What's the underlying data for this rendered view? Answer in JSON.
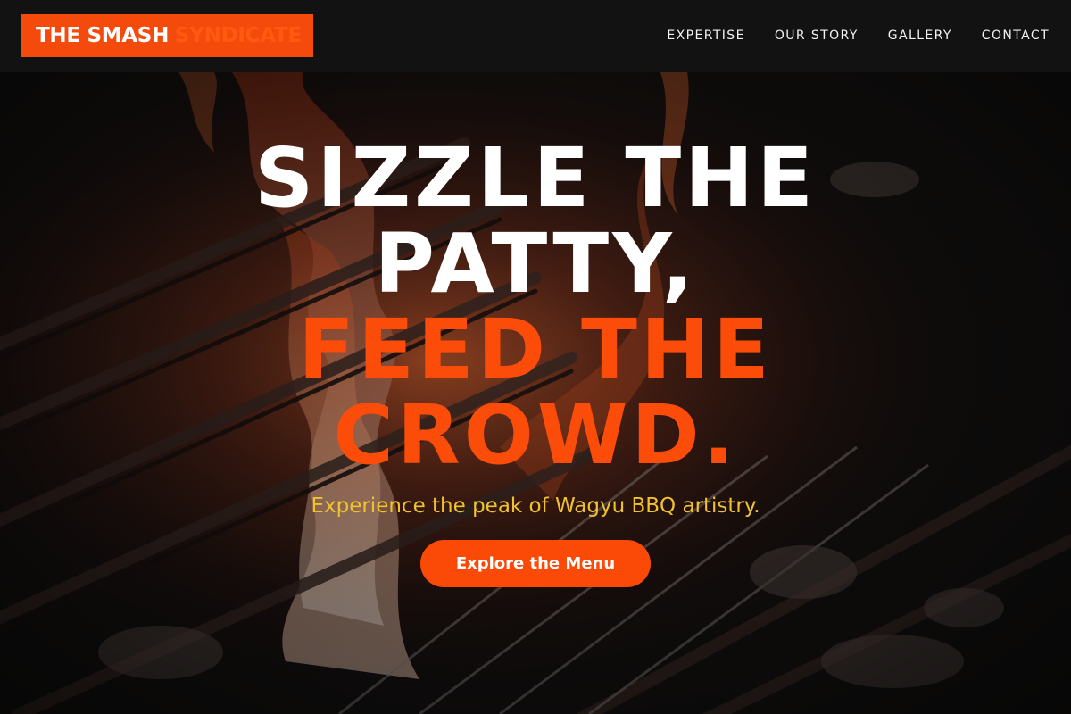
{
  "header": {
    "logo": {
      "part1": "THE SMASH",
      "part2": "SYNDICATE"
    },
    "nav": [
      {
        "label": "EXPERTISE"
      },
      {
        "label": "OUR STORY"
      },
      {
        "label": "GALLERY"
      },
      {
        "label": "CONTACT"
      }
    ]
  },
  "hero": {
    "headline": [
      "SIZZLE THE",
      "PATTY,",
      "FEED THE",
      "CROWD."
    ],
    "tagline": "Experience the peak of Wagyu BBQ artistry.",
    "cta_label": "Explore the Menu",
    "background": "flame-grill-photo"
  },
  "colors": {
    "accent": "#f44a0b",
    "headline_white": "#ffffff",
    "headline_orange": "#fb4d09",
    "tagline": "#f2c12e",
    "header_bg": "#121212"
  }
}
